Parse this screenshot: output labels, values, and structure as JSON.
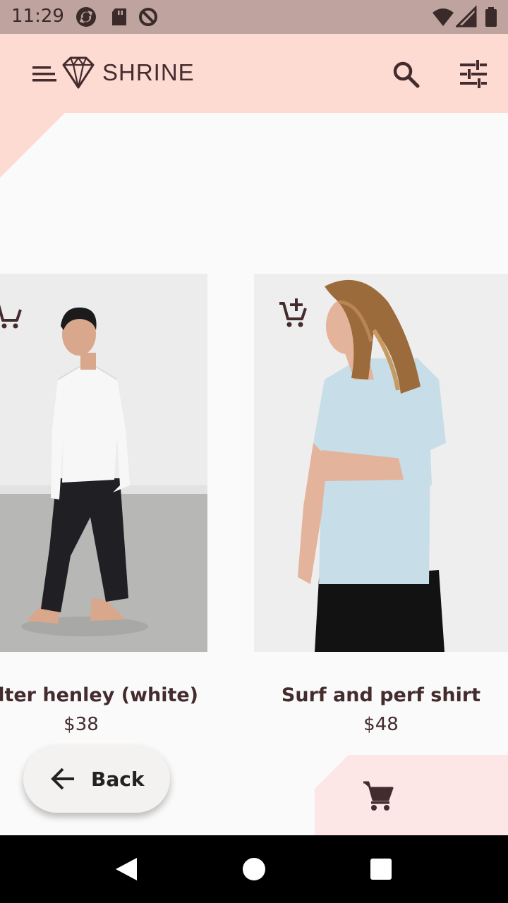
{
  "status_bar": {
    "time": "11:29",
    "left_icons": [
      "sync-icon",
      "sd-card-icon",
      "data-saver-icon"
    ],
    "right_icons": [
      "wifi-icon",
      "signal-icon",
      "battery-icon"
    ]
  },
  "app_bar": {
    "title": "SHRINE",
    "icons": [
      "menu-icon",
      "diamond-logo-icon",
      "search-icon",
      "tune-filter-icon"
    ]
  },
  "products": [
    {
      "name": "alter henley (white)",
      "price": "$38"
    },
    {
      "name": "Surf and perf shirt",
      "price": "$48"
    }
  ],
  "back_button": {
    "label": "Back"
  },
  "cart": {
    "icon": "shopping-cart-icon"
  },
  "colors": {
    "status_bar": "#bfa39f",
    "app_bar": "#fddbd3",
    "backdrop": "#fafafa",
    "text": "#442c2e",
    "cart_panel": "#fde6e6",
    "nav_bar": "#000000"
  }
}
